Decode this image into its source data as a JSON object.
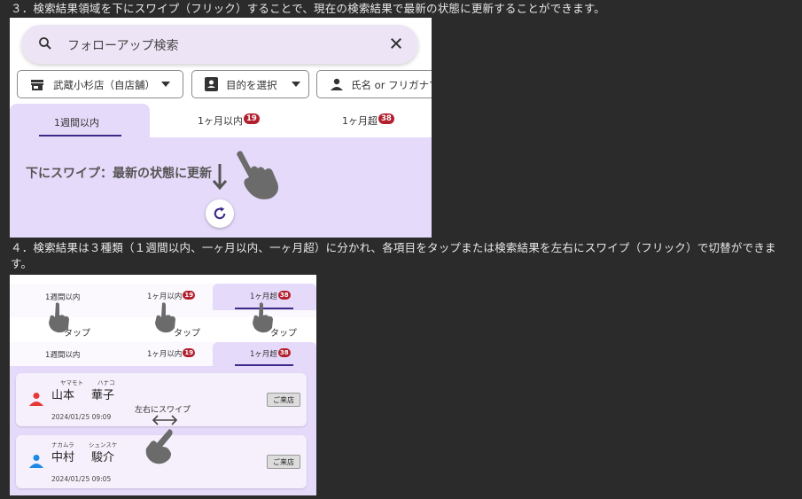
{
  "captions": {
    "step3": "３．検索結果領域を下にスワイプ（フリック）することで、現在の検索結果で最新の状態に更新することができます。",
    "step4_line1": "４．検索結果は３種類（１週間以内、一ヶ月以内、一ヶ月超）に分かれ、各項目をタップまたは検索結果を左右にスワイプ（フリック）で切替ができま",
    "step4_line2": "す。"
  },
  "screen1": {
    "search_placeholder": "フォローアップ検索",
    "filters": {
      "store": "武蔵小杉店（自店舗）",
      "purpose": "目的を選択",
      "name": "氏名 or フリガナで"
    },
    "tabs": [
      {
        "label": "1週間以内",
        "badge": ""
      },
      {
        "label": "1ヶ月以内",
        "badge": "19"
      },
      {
        "label": "1ヶ月超",
        "badge": "38"
      }
    ],
    "swipe_hint": "下にスワイプ：最新の状態に更新"
  },
  "screen2": {
    "tabs": [
      {
        "label": "1週間以内",
        "badge": ""
      },
      {
        "label": "1ヶ月以内",
        "badge": "19"
      },
      {
        "label": "1ヶ月超",
        "badge": "38"
      }
    ],
    "tap_label": "タップ",
    "swipe_hint": "左右にスワイプ",
    "cards": [
      {
        "furi_last": "ヤマモト",
        "furi_first": "ハナコ",
        "last": "山本",
        "first": "華子",
        "date": "2024/01/25 09:09",
        "visit": "ご来店",
        "avatar_color": "#e53935"
      },
      {
        "furi_last": "ナカムラ",
        "furi_first": "シュンスケ",
        "last": "中村",
        "first": "駿介",
        "date": "2024/01/25 09:05",
        "visit": "ご来店",
        "avatar_color": "#1e88e5"
      }
    ],
    "accent": "#3f2a8a",
    "tab_active_bg": "#e6dafa"
  }
}
